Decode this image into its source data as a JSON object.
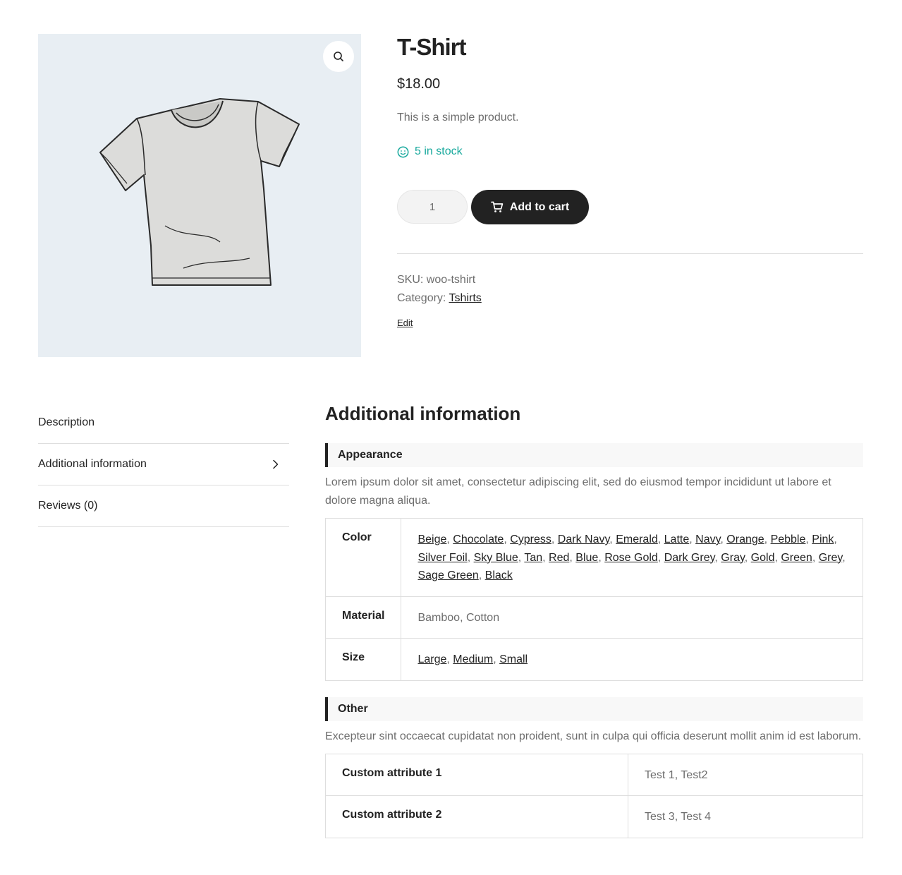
{
  "product": {
    "title": "T-Shirt",
    "price": "$18.00",
    "short_description": "This is a simple product.",
    "stock": "5 in stock",
    "quantity": "1",
    "add_to_cart": "Add to cart",
    "sku_label": "SKU:",
    "sku": "woo-tshirt",
    "category_label": "Category:",
    "category": "Tshirts",
    "edit": "Edit"
  },
  "tabs": [
    {
      "label": "Description"
    },
    {
      "label": "Additional information"
    },
    {
      "label": "Reviews (0)"
    }
  ],
  "additional_info": {
    "heading": "Additional information",
    "groups": [
      {
        "name": "Appearance",
        "description": "Lorem ipsum dolor sit amet, consectetur adipiscing elit, sed do eiusmod tempor incididunt ut labore et dolore magna aliqua.",
        "rows": [
          {
            "label": "Color",
            "links": true,
            "values": [
              "Beige",
              "Chocolate",
              "Cypress",
              "Dark Navy",
              "Emerald",
              "Latte",
              "Navy",
              "Orange",
              "Pebble",
              "Pink",
              "Silver Foil",
              "Sky Blue",
              "Tan",
              "Red",
              "Blue",
              "Rose Gold",
              "Dark Grey",
              "Gray",
              "Gold",
              "Green",
              "Grey",
              "Sage Green",
              "Black"
            ]
          },
          {
            "label": "Material",
            "links": false,
            "values": [
              "Bamboo",
              "Cotton"
            ]
          },
          {
            "label": "Size",
            "links": true,
            "values": [
              "Large",
              "Medium",
              "Small"
            ]
          }
        ]
      },
      {
        "name": "Other",
        "description": "Excepteur sint occaecat cupidatat non proident, sunt in culpa qui officia deserunt mollit anim id est laborum.",
        "rows": [
          {
            "label": "Custom attribute 1",
            "links": false,
            "values": [
              "Test 1",
              "Test2"
            ]
          },
          {
            "label": "Custom attribute 2",
            "links": false,
            "values": [
              "Test 3",
              "Test 4"
            ]
          }
        ]
      }
    ]
  },
  "colors": {
    "accent_stock": "#16a89c",
    "button": "#222222",
    "image_bg": "#e8eef3"
  },
  "icons": {
    "zoom": "magnifier-icon",
    "stock": "smiley-icon",
    "cart": "cart-icon",
    "tab_active": "chevron-right-icon"
  }
}
